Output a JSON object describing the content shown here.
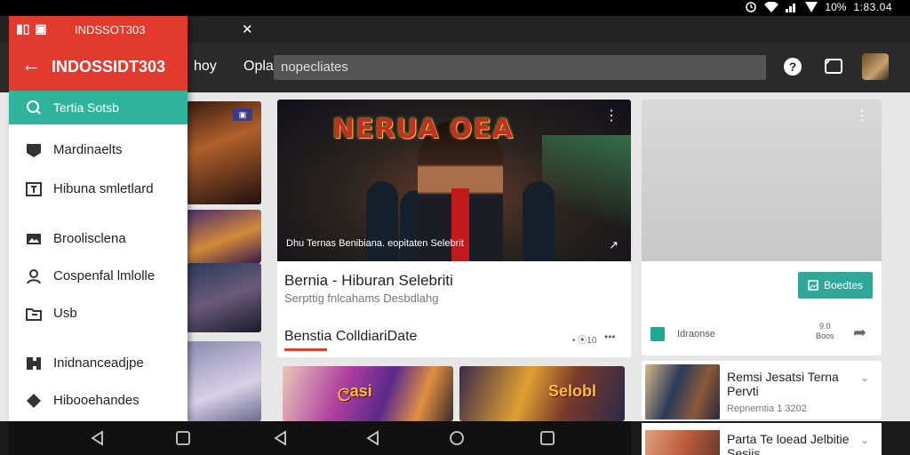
{
  "status_bar": {
    "time": "1:83.04",
    "battery": "10%"
  },
  "drawer": {
    "top_title": "INDSSOT303",
    "title": "INDOSSIDT303",
    "active_item": "Tertia Sotsb",
    "items": [
      {
        "label": "Mardinaelts",
        "icon": "inbox-icon"
      },
      {
        "label": "Hibuna smletlard",
        "icon": "tv-icon"
      },
      {
        "label": "Broolisclena",
        "icon": "image-icon"
      },
      {
        "label": "Cospenfal lmlolle",
        "icon": "person-icon"
      },
      {
        "label": "Usb",
        "icon": "folder-icon"
      },
      {
        "label": "Inidnanceadjpe",
        "icon": "puzzle-icon"
      },
      {
        "label": "Hibooehandes",
        "icon": "tag-icon"
      }
    ]
  },
  "header": {
    "tab1": "hoy",
    "tab2": "Oplaria",
    "search_text": "nopecliates"
  },
  "main_card": {
    "hero_title": "NERUA    OEA",
    "hero_caption": "Dhu Ternas Benibiana. eopitaten Selebrit",
    "title": "Bernia - Hiburan Selebriti",
    "subtitle": "Serpttig fnlcahams Desbdlahg"
  },
  "section": {
    "title": "Benstia  ColldiariDate",
    "meta": "• ⦿10",
    "thumb1_text": "ලasi",
    "thumb2_text": "Selobl"
  },
  "right_card": {
    "button_label": "Boedtes",
    "label": "Idraonse",
    "count_line1": "9.0",
    "count_line2": "Boos"
  },
  "list": [
    {
      "title": "Remsi Jesatsi Terna Pervti",
      "date": "Repnemtia 1 3202"
    },
    {
      "title": "Parta Te loead Jelbitie Sesiis"
    }
  ],
  "colors": {
    "drawer_header": "#e23a2e",
    "accent_teal": "#2fb39d",
    "status_bar": "#000000"
  }
}
